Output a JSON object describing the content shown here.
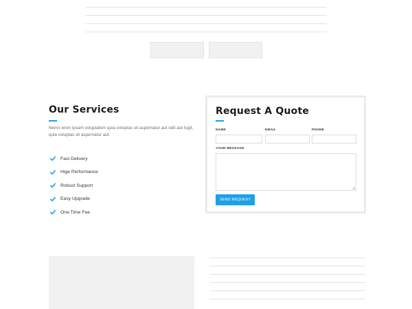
{
  "services": {
    "title": "Our Services",
    "description": "Nemo enim ipsam voluptatem quia voluptas sit aspernatur aut odit aut fugit, quia voluptas sit aspernatur aut.",
    "features": [
      {
        "label": "Fast Delivery",
        "icon": "check-icon"
      },
      {
        "label": "Hige Performance",
        "icon": "check-icon"
      },
      {
        "label": "Robust Support",
        "icon": "check-icon"
      },
      {
        "label": "Easy Upgrade",
        "icon": "check-icon"
      },
      {
        "label": "One Time Fee",
        "icon": "check-icon"
      }
    ]
  },
  "quote": {
    "title": "Request A Quote",
    "name_label": "NAME",
    "email_label": "EMAIL",
    "phone_label": "PHONE",
    "message_label": "YOUR MESSAGE",
    "name_value": "",
    "email_value": "",
    "phone_value": "",
    "message_value": "",
    "send_label": "SEND REQUEST"
  },
  "colors": {
    "accent": "#1e9be6",
    "button": "#1ea0e8",
    "heading": "#1c1c1c",
    "muted_text": "#6f6f6f",
    "placeholder_gray": "#f1f1f1",
    "divider": "#e2e2e2"
  }
}
